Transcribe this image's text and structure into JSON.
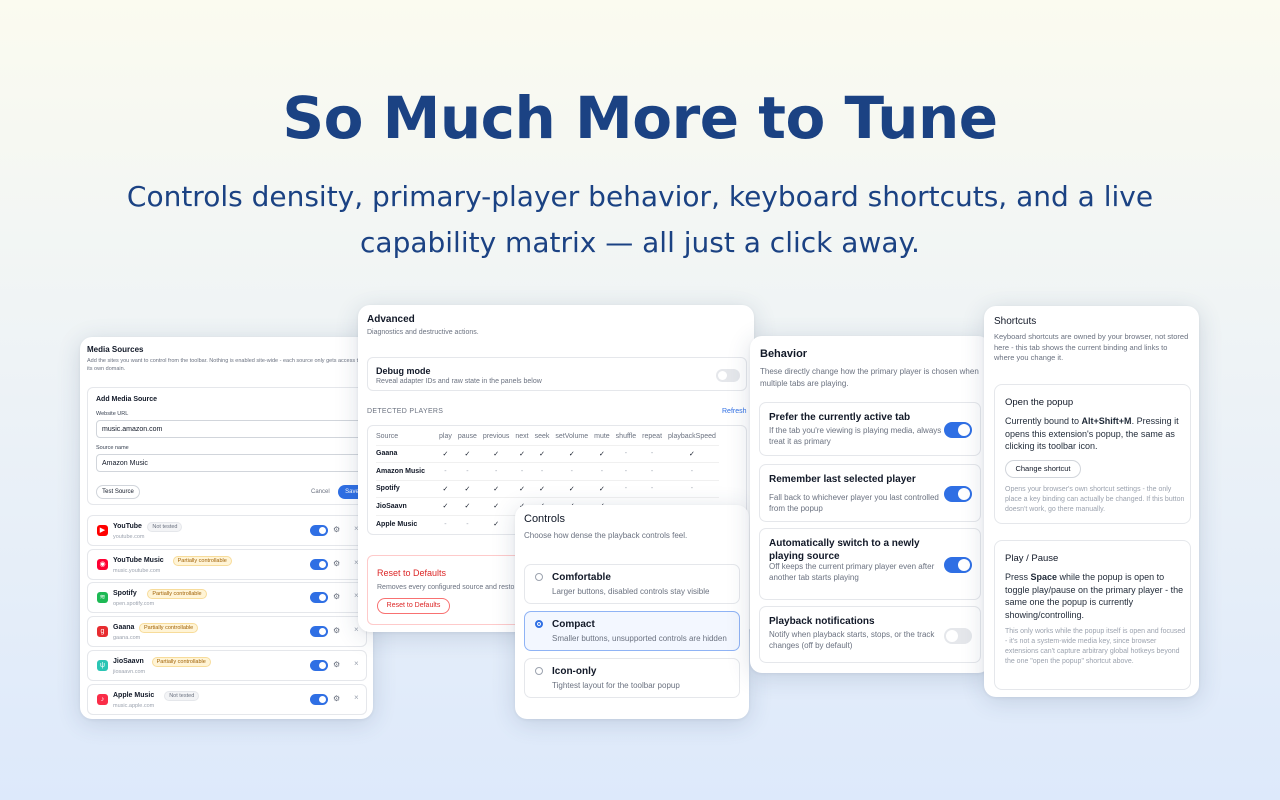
{
  "hero": {
    "title": "So Much More to Tune",
    "subtitle": "Controls density, primary-player behavior, keyboard shortcuts, and a live capability matrix — all just a click away."
  },
  "media_sources": {
    "title": "Media Sources",
    "description": "Add the sites you want to control from the toolbar. Nothing is enabled site-wide - each source only gets access to its own domain.",
    "add_form": {
      "title": "Add Media Source",
      "url_label": "Website URL",
      "url_value": "music.amazon.com",
      "name_label": "Source name",
      "name_value": "Amazon Music",
      "test_button": "Test Source",
      "cancel_button": "Cancel",
      "save_button": "Save"
    },
    "sources": [
      {
        "name": "YouTube",
        "url": "youtube.com",
        "badge": "Not tested",
        "badge_style": "gray",
        "icon": "youtube-icon",
        "color": "#ff0000",
        "glyph": "▶"
      },
      {
        "name": "YouTube Music",
        "url": "music.youtube.com",
        "badge": "Partially controllable",
        "badge_style": "amber",
        "icon": "youtube-music-icon",
        "color": "#ff0033",
        "glyph": "◉"
      },
      {
        "name": "Spotify",
        "url": "open.spotify.com",
        "badge": "Partially controllable",
        "badge_style": "amber",
        "icon": "spotify-icon",
        "color": "#1db954",
        "glyph": "≋"
      },
      {
        "name": "Gaana",
        "url": "gaana.com",
        "badge": "Partially controllable",
        "badge_style": "amber",
        "icon": "gaana-icon",
        "color": "#e72c30",
        "glyph": "g"
      },
      {
        "name": "JioSaavn",
        "url": "jiosaavn.com",
        "badge": "Partially controllable",
        "badge_style": "amber",
        "icon": "jiosaavn-icon",
        "color": "#2bc5b4",
        "glyph": "ψ"
      },
      {
        "name": "Apple Music",
        "url": "music.apple.com",
        "badge": "Not tested",
        "badge_style": "gray",
        "icon": "apple-music-icon",
        "color": "#fa2d48",
        "glyph": "♪"
      }
    ]
  },
  "advanced": {
    "title": "Advanced",
    "description": "Diagnostics and destructive actions.",
    "debug_title": "Debug mode",
    "debug_desc": "Reveal adapter IDs and raw state in the panels below",
    "detected_label": "DETECTED PLAYERS",
    "refresh_label": "Refresh",
    "columns": [
      "Source",
      "play",
      "pause",
      "previous",
      "next",
      "seek",
      "setVolume",
      "mute",
      "shuffle",
      "repeat",
      "playbackSpeed"
    ],
    "rows": [
      {
        "name": "Gaana",
        "cells": [
          "✓",
          "✓",
          "✓",
          "✓",
          "✓",
          "✓",
          "✓",
          "-",
          "-",
          "✓"
        ]
      },
      {
        "name": "Amazon Music",
        "cells": [
          "-",
          "-",
          "-",
          "-",
          "-",
          "-",
          "-",
          "-",
          "-",
          "-"
        ]
      },
      {
        "name": "Spotify",
        "cells": [
          "✓",
          "✓",
          "✓",
          "✓",
          "✓",
          "✓",
          "✓",
          "-",
          "-",
          "-"
        ]
      },
      {
        "name": "JioSaavn",
        "cells": [
          "✓",
          "✓",
          "✓",
          "✓",
          "✓",
          "✓",
          "✓",
          "-",
          "-",
          "-"
        ]
      },
      {
        "name": "Apple Music",
        "cells": [
          "-",
          "-",
          "✓",
          "-",
          "-",
          "-",
          "-",
          "-",
          "-",
          "-"
        ]
      }
    ],
    "reset_title": "Reset to Defaults",
    "reset_desc": "Removes every configured source and resto",
    "reset_button": "Reset to Defaults"
  },
  "controls": {
    "title": "Controls",
    "description": "Choose how dense the playback controls feel.",
    "options": [
      {
        "title": "Comfortable",
        "desc": "Larger buttons, disabled controls stay visible",
        "selected": false
      },
      {
        "title": "Compact",
        "desc": "Smaller buttons, unsupported controls are hidden",
        "selected": true
      },
      {
        "title": "Icon-only",
        "desc": "Tightest layout for the toolbar popup",
        "selected": false
      }
    ]
  },
  "behavior": {
    "title": "Behavior",
    "description": "These directly change how the primary player is chosen when multiple tabs are playing.",
    "items": [
      {
        "title": "Prefer the currently active tab",
        "desc": "If the tab you're viewing is playing media, always treat it as primary",
        "enabled": true
      },
      {
        "title": "Remember last selected player",
        "desc": "Fall back to whichever player you last controlled from the popup",
        "enabled": true
      },
      {
        "title": "Automatically switch to a newly playing source",
        "desc": "Off keeps the current primary player even after another tab starts playing",
        "enabled": true
      },
      {
        "title": "Playback notifications",
        "desc": "Notify when playback starts, stops, or the track changes (off by default)",
        "enabled": false
      }
    ]
  },
  "shortcuts": {
    "title": "Shortcuts",
    "description": "Keyboard shortcuts are owned by your browser, not stored here - this tab shows the current binding and links to where you change it.",
    "popup": {
      "title": "Open the popup",
      "text_pre": "Currently bound to ",
      "binding": "Alt+Shift+M",
      "text_post": ". Pressing it opens this extension's popup, the same as clicking its toolbar icon.",
      "button": "Change shortcut",
      "note": "Opens your browser's own shortcut settings - the only place a key binding can actually be changed. If this button doesn't work, go there manually."
    },
    "playpause": {
      "title": "Play / Pause",
      "text_pre": "Press ",
      "key": "Space",
      "text_post": " while the popup is open to toggle play/pause on the primary player - the same one the popup is currently showing/controlling.",
      "note": "This only works while the popup itself is open and focused - it's not a system-wide media key, since browser extensions can't capture arbitrary global hotkeys beyond the one \"open the popup\" shortcut above."
    }
  },
  "colors": {
    "brand": "#1b4283",
    "accent": "#2f6fe4",
    "danger": "#dc2626"
  }
}
